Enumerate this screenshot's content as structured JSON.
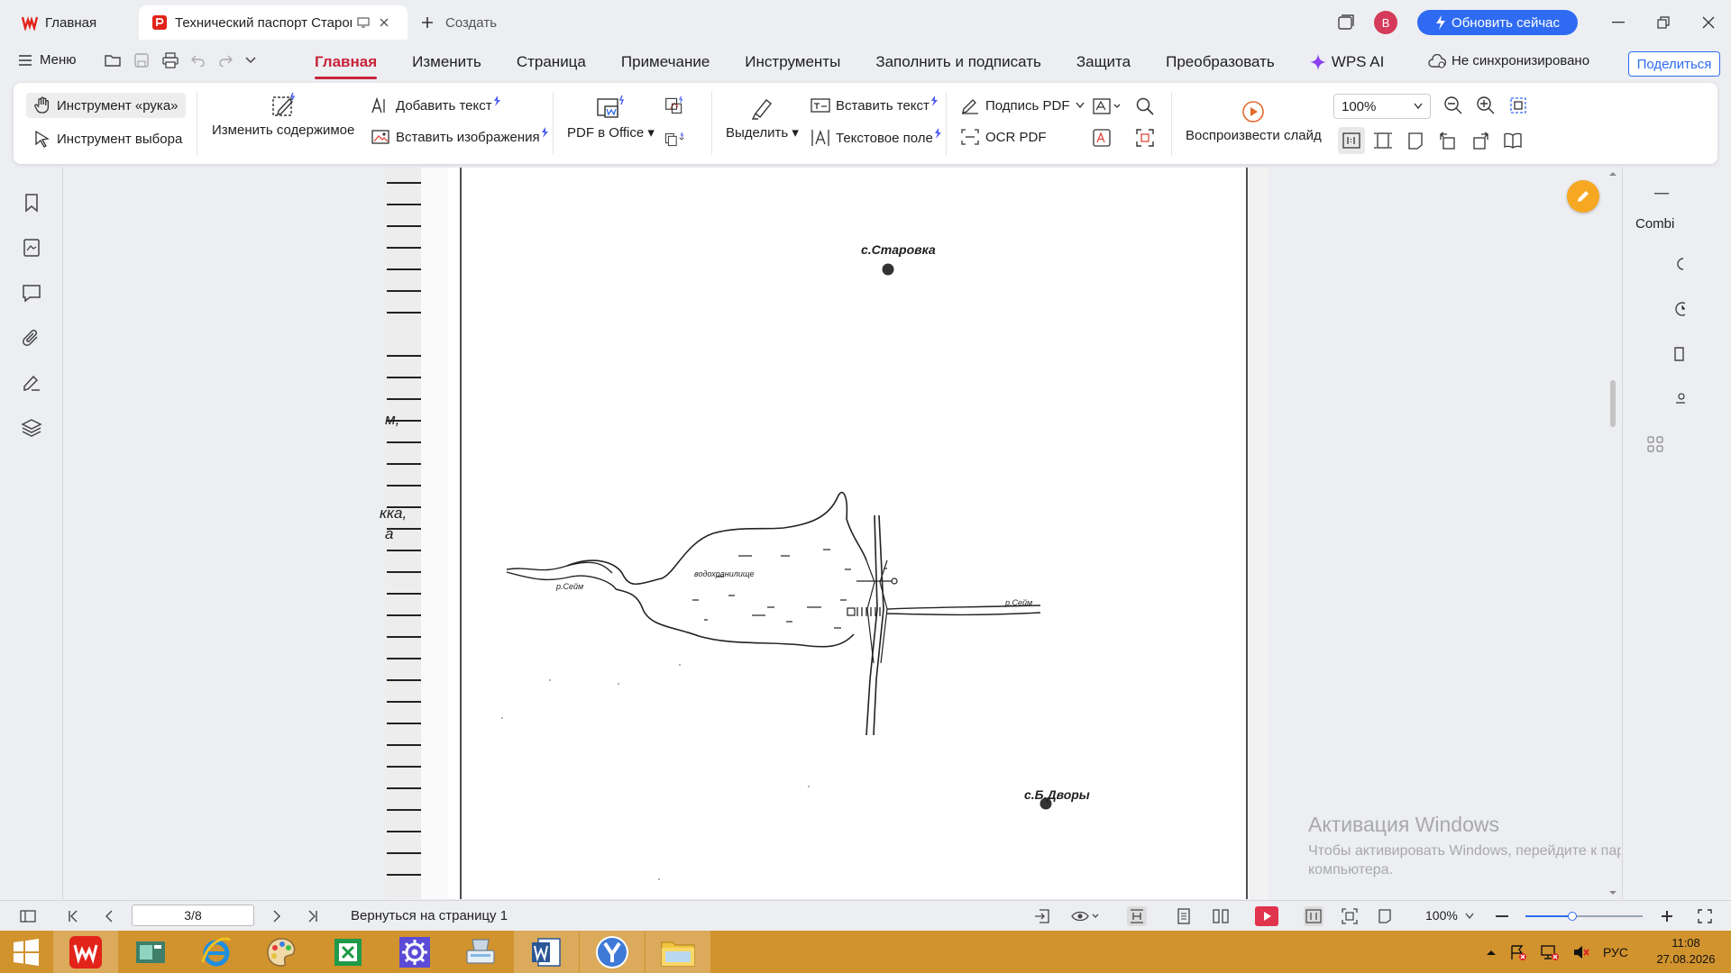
{
  "tabs": {
    "home_label": "Главная",
    "doc_title": "Технический паспорт Старовского водохранилища",
    "new_label": "Создать"
  },
  "titlebar": {
    "avatar_letter": "В",
    "upgrade_label": "Обновить сейчас"
  },
  "menu": {
    "menu_label": "Меню",
    "tabs": [
      "Главная",
      "Изменить",
      "Страница",
      "Примечание",
      "Инструменты",
      "Заполнить и подписать",
      "Защита",
      "Преобразовать",
      "WPS AI"
    ],
    "sync_label": "Не синхронизировано",
    "share_label": "Поделиться"
  },
  "ribbon": {
    "hand_tool": "Инструмент «рука»",
    "select_tool": "Инструмент выбора",
    "edit_content": "Изменить содержимое",
    "add_text": "Добавить текст",
    "insert_image": "Вставить изображения",
    "pdf_to_office": "PDF в Office",
    "highlight": "Выделить",
    "insert_text": "Вставить текст",
    "text_field": "Текстовое поле",
    "sign_pdf": "Подпись PDF",
    "ocr_pdf": "OCR PDF",
    "play_slide": "Воспроизвести слайд",
    "zoom": "100%"
  },
  "document": {
    "village_top": "с.Старовка",
    "village_bottom": "с.Б.Дворы",
    "reservoir": "водохранилище",
    "river_left": "р.Сейм",
    "river_right": "р.Сейм",
    "fragment_1": "м,",
    "fragment_2": "кка,",
    "fragment_3": "а"
  },
  "right_panel": {
    "title": "Combi"
  },
  "watermark": {
    "title": "Активация Windows",
    "text": "Чтобы активировать Windows, перейдите к параметрам компьютера."
  },
  "statusbar": {
    "page_indicator": "3/8",
    "back_link": "Вернуться на страницу 1",
    "zoom": "100%",
    "zoom_slider_level": 0.4
  },
  "taskbar": {
    "apps": [
      "wps-office",
      "media-center",
      "internet-explorer",
      "paint",
      "excel",
      "settings",
      "scanner",
      "word",
      "yandex-browser",
      "file-explorer"
    ],
    "language": "РУС",
    "time": "11:08",
    "date": "27.08.2026"
  },
  "colors": {
    "accent": "#c7243a",
    "upgrade": "#2f6bf2",
    "taskbar": "#d1932e",
    "edit_fab": "#f7a823"
  }
}
